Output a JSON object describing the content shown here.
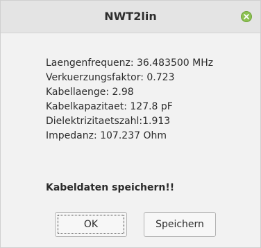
{
  "window": {
    "title": "NWT2lin",
    "close_icon": "close-icon"
  },
  "info": {
    "lines": [
      "Laengenfrequenz: 36.483500 MHz",
      "Verkuerzungsfaktor: 0.723",
      "Kabellaenge: 2.98",
      "Kabelkapazitaet: 127.8 pF",
      "Dielektrizitaetszahl:1.913",
      "Impedanz: 107.237 Ohm"
    ]
  },
  "message": "Kabeldaten speichern!!",
  "buttons": {
    "ok_label": "OK",
    "save_label": "Speichern"
  },
  "colors": {
    "titlebar": "#e4e4e4",
    "background": "#f2f2f2",
    "close_button": "#8cc152"
  }
}
